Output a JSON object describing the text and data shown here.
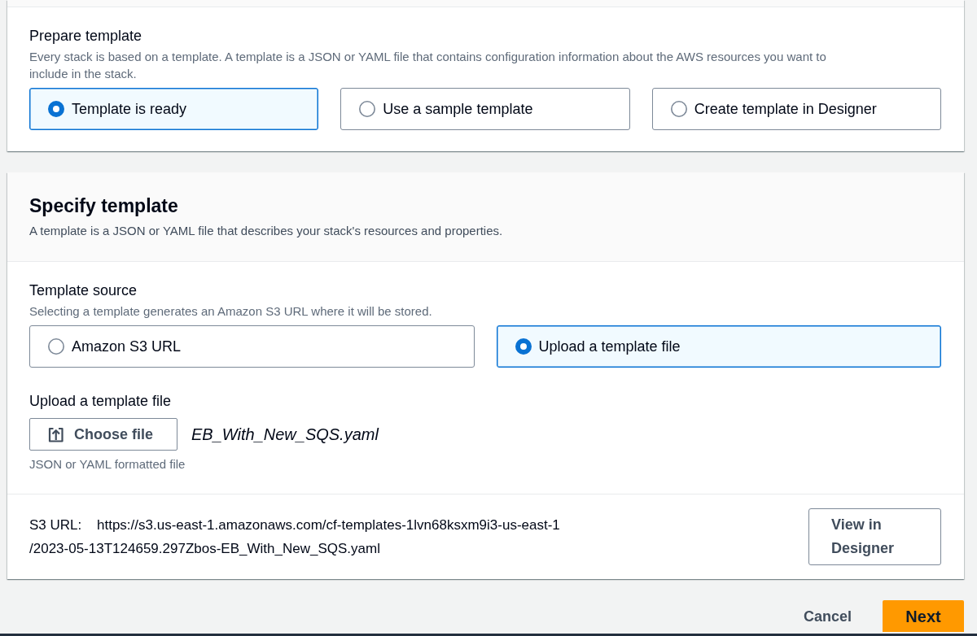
{
  "prepare_template": {
    "label": "Prepare template",
    "description": "Every stack is based on a template. A template is a JSON or YAML file that contains configuration information about the AWS resources you want to include in the stack.",
    "options": [
      {
        "label": "Template is ready",
        "selected": true
      },
      {
        "label": "Use a sample template",
        "selected": false
      },
      {
        "label": "Create template in Designer",
        "selected": false
      }
    ]
  },
  "specify_template": {
    "title": "Specify template",
    "description": "A template is a JSON or YAML file that describes your stack's resources and properties.",
    "template_source": {
      "label": "Template source",
      "description": "Selecting a template generates an Amazon S3 URL where it will be stored.",
      "options": [
        {
          "label": "Amazon S3 URL",
          "selected": false
        },
        {
          "label": "Upload a template file",
          "selected": true
        }
      ]
    },
    "upload": {
      "label": "Upload a template file",
      "button": "Choose file",
      "file_name": "EB_With_New_SQS.yaml",
      "hint": "JSON or YAML formatted file"
    },
    "s3_url": {
      "label": "S3 URL:",
      "value": "https://s3.us-east-1.amazonaws.com/cf-templates-1lvn68ksxm9i3-us-east-1/2023-05-13T124659.297Zbos-EB_With_New_SQS.yaml",
      "button": "View in Designer"
    }
  },
  "footer": {
    "buttons": [
      {
        "label": "Cancel",
        "kind": "link"
      },
      {
        "label": "Next",
        "kind": "primary"
      }
    ]
  }
}
